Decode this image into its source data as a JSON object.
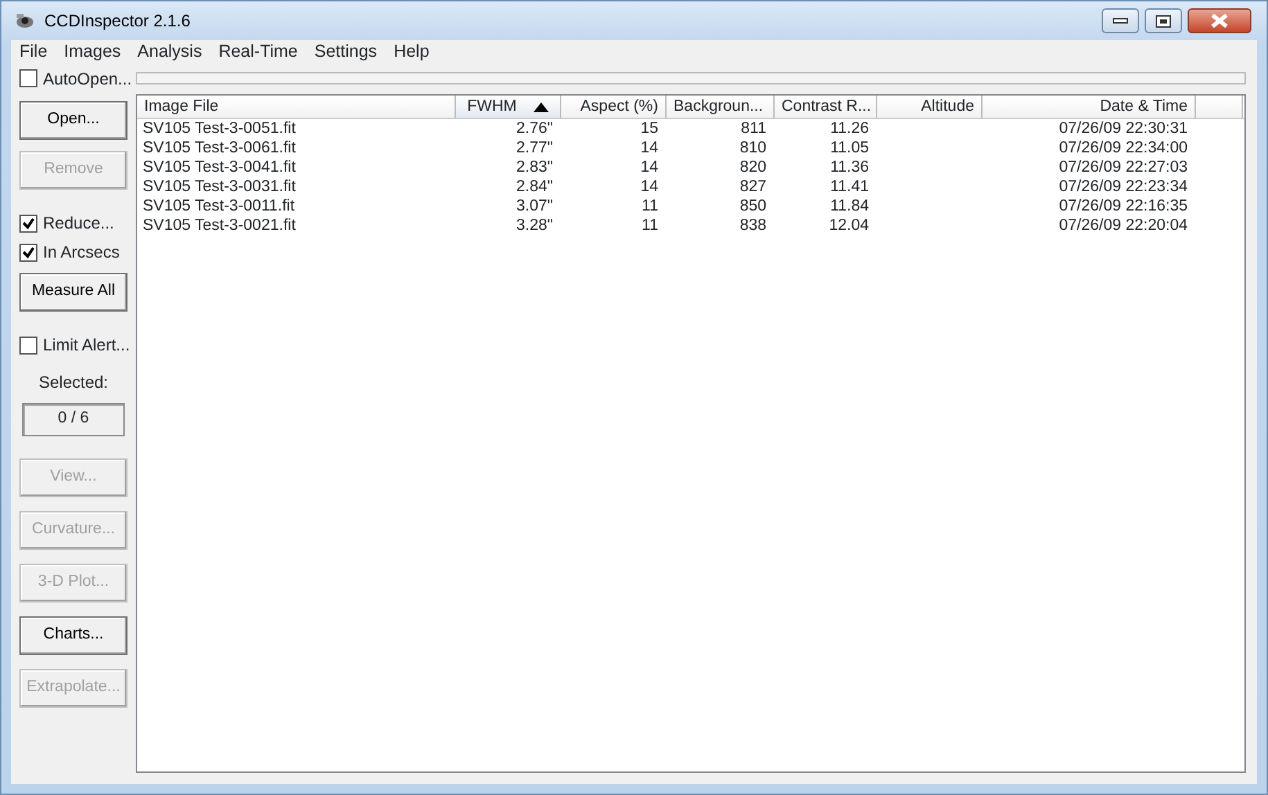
{
  "window": {
    "title": "CCDInspector 2.1.6"
  },
  "menu": [
    "File",
    "Images",
    "Analysis",
    "Real-Time",
    "Settings",
    "Help"
  ],
  "auto_open": {
    "label": "AutoOpen...",
    "checked": false
  },
  "progress": {
    "level": 0
  },
  "sidebar": [
    {
      "kind": "button",
      "label": "Open...",
      "disabled": false
    },
    {
      "kind": "button",
      "label": "Remove",
      "disabled": true
    },
    {
      "kind": "checkbox",
      "label": "Reduce...",
      "checked": true
    },
    {
      "kind": "checkbox",
      "label": "In Arcsecs",
      "checked": true
    },
    {
      "kind": "button",
      "label": "Measure All",
      "disabled": false
    },
    {
      "kind": "checkbox",
      "label": "Limit Alert...",
      "checked": false
    },
    {
      "kind": "label",
      "label": "Selected:"
    },
    {
      "kind": "readout",
      "label": "0 / 6"
    },
    {
      "kind": "button",
      "label": "View...",
      "disabled": true
    },
    {
      "kind": "button",
      "label": "Curvature...",
      "disabled": true
    },
    {
      "kind": "button",
      "label": "3-D Plot...",
      "disabled": true
    },
    {
      "kind": "button",
      "label": "Charts...",
      "disabled": false
    },
    {
      "kind": "button",
      "label": "Extrapolate...",
      "disabled": true
    }
  ],
  "table": {
    "columns": [
      {
        "label": "Image File",
        "sorted": false
      },
      {
        "label": "FWHM",
        "sorted": true
      },
      {
        "label": "Aspect (%)",
        "sorted": false
      },
      {
        "label": "Backgroun...",
        "sorted": false
      },
      {
        "label": "Contrast R...",
        "sorted": false
      },
      {
        "label": "Altitude",
        "sorted": false
      },
      {
        "label": "Date & Time",
        "sorted": false
      }
    ],
    "rows": [
      [
        "SV105 Test-3-0051.fit",
        "2.76\"",
        "15",
        "811",
        "11.26",
        "",
        "07/26/09 22:30:31"
      ],
      [
        "SV105 Test-3-0061.fit",
        "2.77\"",
        "14",
        "810",
        "11.05",
        "",
        "07/26/09 22:34:00"
      ],
      [
        "SV105 Test-3-0041.fit",
        "2.83\"",
        "14",
        "820",
        "11.36",
        "",
        "07/26/09 22:27:03"
      ],
      [
        "SV105 Test-3-0031.fit",
        "2.84\"",
        "14",
        "827",
        "11.41",
        "",
        "07/26/09 22:23:34"
      ],
      [
        "SV105 Test-3-0011.fit",
        "3.07\"",
        "11",
        "850",
        "11.84",
        "",
        "07/26/09 22:16:35"
      ],
      [
        "SV105 Test-3-0021.fit",
        "3.28\"",
        "11",
        "838",
        "12.04",
        "",
        "07/26/09 22:20:04"
      ]
    ]
  }
}
